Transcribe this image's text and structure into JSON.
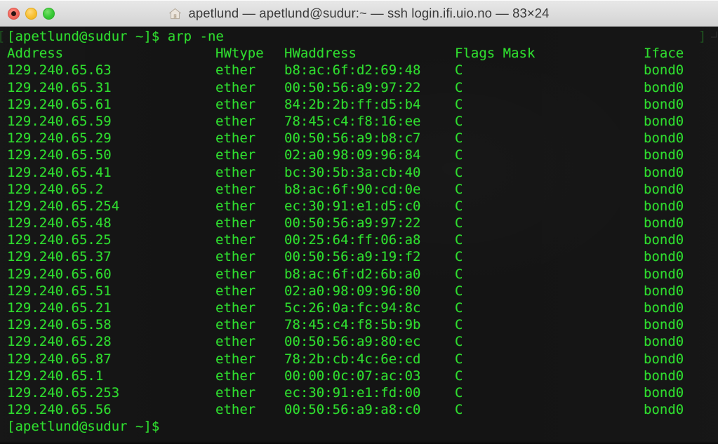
{
  "window": {
    "title": "apetlund — apetlund@sudur:~ — ssh login.ifi.uio.no — 83×24",
    "icon": "home-icon",
    "columns": 83,
    "rows": 24,
    "controls": {
      "close_label": "",
      "minimize_label": "",
      "maximize_label": ""
    }
  },
  "theme": {
    "titlebar_bg": "#dedede",
    "title_color": "#3a3a3a",
    "terminal_bg": "#141414",
    "text_green": "#2fdd2f",
    "dim_green": "#1f5a20",
    "close_red": "#f1685c",
    "minimize_yellow": "#f8c033",
    "maximize_green": "#37c935"
  },
  "terminal": {
    "prompt": "[apetlund@sudur ~]$",
    "command": "arp -ne",
    "command_line": "[apetlund@sudur ~]$ arp -ne",
    "wrap_marker_left": "[",
    "wrap_marker_right": "]",
    "final_prompt": "[apetlund@sudur ~]$",
    "headers": {
      "address": "Address",
      "hwtype": "HWtype",
      "hwaddress": "HWaddress",
      "flags_mask": "Flags Mask",
      "iface": "Iface"
    },
    "rows": [
      {
        "address": "129.240.65.63",
        "hwtype": "ether",
        "hwaddress": "b8:ac:6f:d2:69:48",
        "flags": "C",
        "iface": "bond0"
      },
      {
        "address": "129.240.65.31",
        "hwtype": "ether",
        "hwaddress": "00:50:56:a9:97:22",
        "flags": "C",
        "iface": "bond0"
      },
      {
        "address": "129.240.65.61",
        "hwtype": "ether",
        "hwaddress": "84:2b:2b:ff:d5:b4",
        "flags": "C",
        "iface": "bond0"
      },
      {
        "address": "129.240.65.59",
        "hwtype": "ether",
        "hwaddress": "78:45:c4:f8:16:ee",
        "flags": "C",
        "iface": "bond0"
      },
      {
        "address": "129.240.65.29",
        "hwtype": "ether",
        "hwaddress": "00:50:56:a9:b8:c7",
        "flags": "C",
        "iface": "bond0"
      },
      {
        "address": "129.240.65.50",
        "hwtype": "ether",
        "hwaddress": "02:a0:98:09:96:84",
        "flags": "C",
        "iface": "bond0"
      },
      {
        "address": "129.240.65.41",
        "hwtype": "ether",
        "hwaddress": "bc:30:5b:3a:cb:40",
        "flags": "C",
        "iface": "bond0"
      },
      {
        "address": "129.240.65.2",
        "hwtype": "ether",
        "hwaddress": "b8:ac:6f:90:cd:0e",
        "flags": "C",
        "iface": "bond0"
      },
      {
        "address": "129.240.65.254",
        "hwtype": "ether",
        "hwaddress": "ec:30:91:e1:d5:c0",
        "flags": "C",
        "iface": "bond0"
      },
      {
        "address": "129.240.65.48",
        "hwtype": "ether",
        "hwaddress": "00:50:56:a9:97:22",
        "flags": "C",
        "iface": "bond0"
      },
      {
        "address": "129.240.65.25",
        "hwtype": "ether",
        "hwaddress": "00:25:64:ff:06:a8",
        "flags": "C",
        "iface": "bond0"
      },
      {
        "address": "129.240.65.37",
        "hwtype": "ether",
        "hwaddress": "00:50:56:a9:19:f2",
        "flags": "C",
        "iface": "bond0"
      },
      {
        "address": "129.240.65.60",
        "hwtype": "ether",
        "hwaddress": "b8:ac:6f:d2:6b:a0",
        "flags": "C",
        "iface": "bond0"
      },
      {
        "address": "129.240.65.51",
        "hwtype": "ether",
        "hwaddress": "02:a0:98:09:96:80",
        "flags": "C",
        "iface": "bond0"
      },
      {
        "address": "129.240.65.21",
        "hwtype": "ether",
        "hwaddress": "5c:26:0a:fc:94:8c",
        "flags": "C",
        "iface": "bond0"
      },
      {
        "address": "129.240.65.58",
        "hwtype": "ether",
        "hwaddress": "78:45:c4:f8:5b:9b",
        "flags": "C",
        "iface": "bond0"
      },
      {
        "address": "129.240.65.28",
        "hwtype": "ether",
        "hwaddress": "00:50:56:a9:80:ec",
        "flags": "C",
        "iface": "bond0"
      },
      {
        "address": "129.240.65.87",
        "hwtype": "ether",
        "hwaddress": "78:2b:cb:4c:6e:cd",
        "flags": "C",
        "iface": "bond0"
      },
      {
        "address": "129.240.65.1",
        "hwtype": "ether",
        "hwaddress": "00:00:0c:07:ac:03",
        "flags": "C",
        "iface": "bond0"
      },
      {
        "address": "129.240.65.253",
        "hwtype": "ether",
        "hwaddress": "ec:30:91:e1:fd:00",
        "flags": "C",
        "iface": "bond0"
      },
      {
        "address": "129.240.65.56",
        "hwtype": "ether",
        "hwaddress": "00:50:56:a9:a8:c0",
        "flags": "C",
        "iface": "bond0"
      }
    ]
  }
}
